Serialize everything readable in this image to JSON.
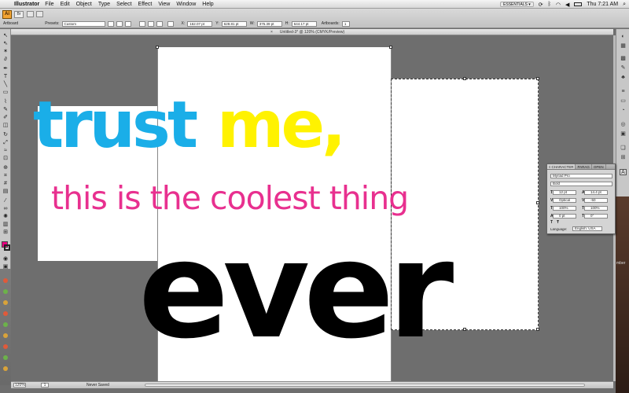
{
  "menubar": {
    "app": "Illustrator",
    "items": [
      "File",
      "Edit",
      "Object",
      "Type",
      "Select",
      "Effect",
      "View",
      "Window",
      "Help"
    ],
    "workspace": "ESSENTIALS ▾",
    "clock": "Thu 7:21 AM",
    "search_icon": "spotlight-icon"
  },
  "controlbar": {
    "logo": "Ai",
    "bridge": "Br",
    "context_label": "Artboard",
    "presets_label": "Presets:",
    "preset_value": "Custom",
    "x_label": "X:",
    "x_value": "162.07 pt",
    "y_label": "Y:",
    "y_value": "628.81 pt",
    "w_label": "W:",
    "w_value": "375.39 pt",
    "h_label": "H:",
    "h_value": "644.17 pt",
    "artboards_label": "Artboards:",
    "artboards_value": "1"
  },
  "document": {
    "tab_title": "Untitled-3* @ 120% (CMYK/Preview)"
  },
  "artwork": {
    "line1_word1": "trust",
    "line1_word2": "me,",
    "line2": "this is the coolest thing",
    "line3": "ever",
    "colors": {
      "cyan": "#1aaee8",
      "yellow": "#fff200",
      "magenta": "#e8308f",
      "black": "#000000"
    }
  },
  "statusbar": {
    "zoom": "120%",
    "artboard": "1",
    "status": "Never Saved"
  },
  "character_panel": {
    "tabs": [
      "◊ CHARACTER",
      "PARAG",
      "OPEN"
    ],
    "font_family": "Myriad Pro",
    "font_style": "Bold",
    "font_size": "12 pt",
    "leading": "14.4 pt",
    "kerning": "Optical",
    "tracking": "-50",
    "vertical_scale": "100%",
    "horizontal_scale": "100%",
    "baseline_shift": "0 pt",
    "rotation": "0°",
    "language_label": "Language:",
    "language": "English: USA"
  },
  "desktop": {
    "right_edge_fragment": "mber"
  }
}
